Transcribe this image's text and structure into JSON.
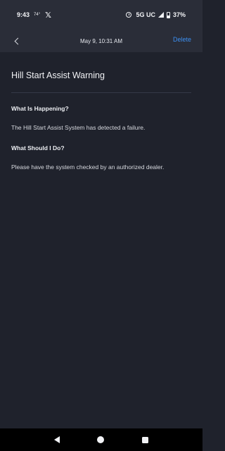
{
  "status_bar": {
    "time": "9:43",
    "temperature": "74°",
    "x_app": "𝕏",
    "network": "5G UC",
    "battery": "37%"
  },
  "header": {
    "title": "May 9, 10:31 AM",
    "delete_label": "Delete"
  },
  "message": {
    "title": "Hill Start Assist Warning",
    "sections": [
      {
        "heading": "What Is Happening?",
        "body": "The Hill Start Assist System has detected a failure."
      },
      {
        "heading": "What Should I Do?",
        "body": "Please have the system checked by an authorized dealer."
      }
    ]
  },
  "colors": {
    "background": "#1f222c",
    "header_background": "#2a2d38",
    "accent": "#3c8ff0"
  }
}
